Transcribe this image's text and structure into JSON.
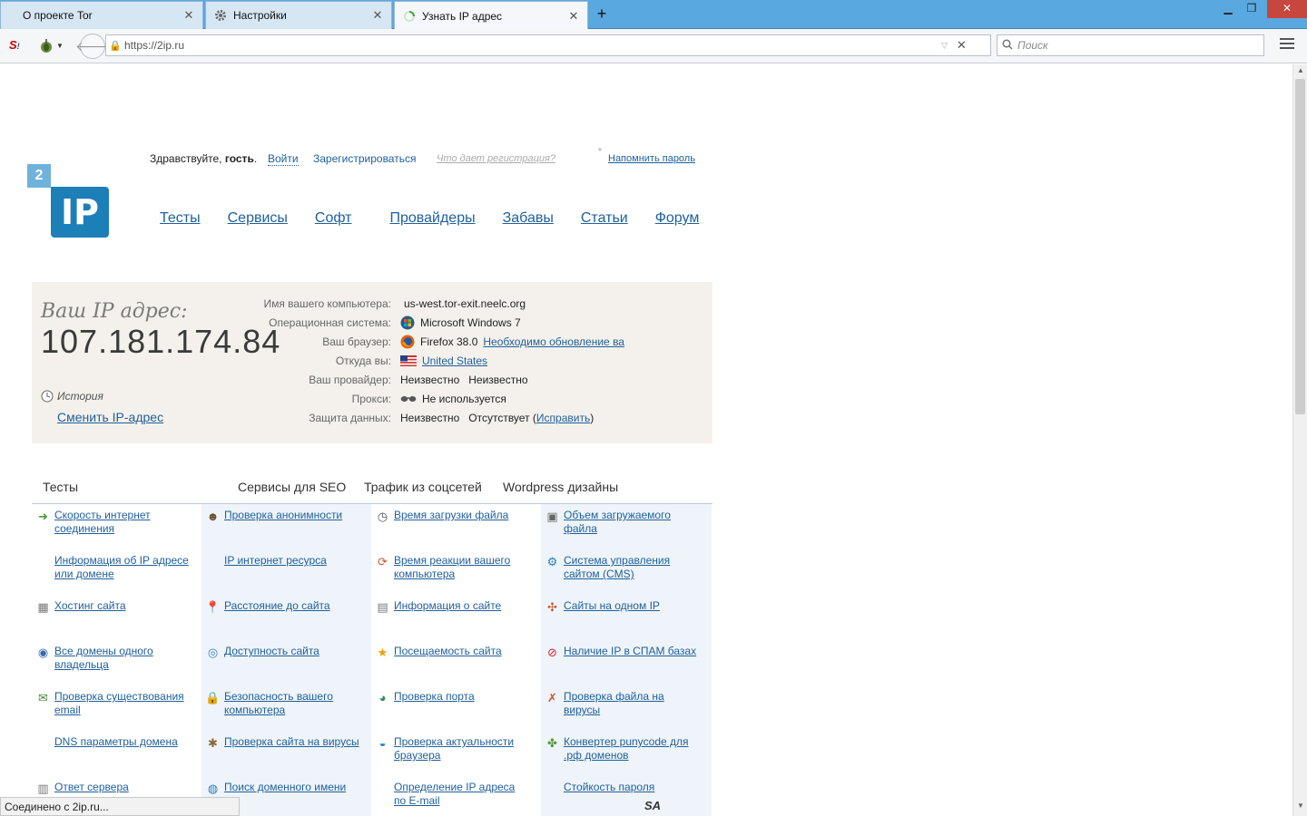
{
  "browser": {
    "tabs": [
      {
        "title": "О проекте Tor",
        "icon": "tor-onion-icon"
      },
      {
        "title": "Настройки",
        "icon": "gear-icon"
      },
      {
        "title": "Узнать IP адрес",
        "icon": "loading-spinner-icon"
      }
    ],
    "url": "https://2ip.ru",
    "search_placeholder": "Поиск"
  },
  "header": {
    "greeting": "Здравствуйте,",
    "guest": "гость",
    "login": "Войти",
    "register": "Зарегистрироваться",
    "why_register": "Что дает регистрация?",
    "remind_password": "Напомнить пароль",
    "logo_number": "2",
    "logo_text": "IP"
  },
  "nav": [
    "Тесты",
    "Сервисы",
    "Софт",
    "Провайдеры",
    "Забавы",
    "Статьи",
    "Форум"
  ],
  "ip_panel": {
    "label": "Ваш IP адрес:",
    "ip": "107.181.174.84",
    "history": "История",
    "change_ip": "Сменить IP-адрес",
    "rows": [
      {
        "label": "Имя вашего компьютера:",
        "value": "us-west.tor-exit.neelc.org"
      },
      {
        "label": "Операционная система:",
        "value": "Microsoft Windows 7"
      },
      {
        "label": "Ваш браузер:",
        "value": "Firefox 38.0",
        "link": "Необходимо обновление ва"
      },
      {
        "label": "Откуда вы:",
        "value": "United States"
      },
      {
        "label": "Ваш провайдер:",
        "value": "Неизвестно",
        "value2": "Неизвестно"
      },
      {
        "label": "Прокси:",
        "value": "Не используется"
      },
      {
        "label": "Защита данных:",
        "value": "Неизвестно",
        "value2": "Отсутствует",
        "link": "Исправить"
      }
    ]
  },
  "sections": [
    "Тесты",
    "Сервисы для SEO",
    "Трафик из соцсетей",
    "Wordpress дизайны"
  ],
  "tests": [
    {
      "line1": "Скорость интернет",
      "line2": "соединения",
      "icon": "speed-arrow-icon"
    },
    {
      "line1": "Проверка анонимности",
      "line2": "",
      "icon": "person-icon"
    },
    {
      "line1": "Время загрузки файла",
      "line2": "",
      "icon": "clock-icon"
    },
    {
      "line1": "Объем загружаемого",
      "line2": "файла",
      "icon": "frame-icon"
    },
    {
      "line1": "Информация об IP адресе",
      "line2": "или домене",
      "icon": ""
    },
    {
      "line1": "IP интернет ресурса",
      "line2": "",
      "icon": ""
    },
    {
      "line1": "Время реакции вашего",
      "line2": "компьютера",
      "icon": "refresh-icon"
    },
    {
      "line1": "Система управления",
      "line2": "сайтом (CMS)",
      "icon": "cms-icon"
    },
    {
      "line1": "Хостинг сайта",
      "line2": "",
      "icon": "table-icon"
    },
    {
      "line1": "Расстояние до сайта",
      "line2": "",
      "icon": "map-pin-icon"
    },
    {
      "line1": "Информация о сайте",
      "line2": "",
      "icon": "document-icon"
    },
    {
      "line1": "Сайты на одном IP",
      "line2": "",
      "icon": "network-icon"
    },
    {
      "line1": "Все домены одного",
      "line2": "владельца",
      "icon": "globe-icon"
    },
    {
      "line1": "Доступность сайта",
      "line2": "",
      "icon": "globe-check-icon"
    },
    {
      "line1": "Посещаемость сайта",
      "line2": "",
      "icon": "star-icon"
    },
    {
      "line1": "Наличие IP в СПАМ базах",
      "line2": "",
      "icon": "no-entry-icon"
    },
    {
      "line1": "Проверка существования",
      "line2": "email",
      "icon": "envelope-icon"
    },
    {
      "line1": "Безопасность вашего",
      "line2": "компьютера",
      "icon": "lock-icon"
    },
    {
      "line1": "Проверка порта",
      "line2": "",
      "icon": "earth-icon"
    },
    {
      "line1": "Проверка файла на",
      "line2": "вирусы",
      "icon": "virus-icon"
    },
    {
      "line1": "DNS параметры домена",
      "line2": "",
      "icon": ""
    },
    {
      "line1": "Проверка сайта на вирусы",
      "line2": "",
      "icon": "bug-icon"
    },
    {
      "line1": "Проверка актуальности",
      "line2": "браузера",
      "icon": "browser-icon"
    },
    {
      "line1": "Конвертер punycode для",
      "line2": ".рф доменов",
      "icon": "puzzle-icon"
    },
    {
      "line1": "Ответ сервера",
      "line2": "",
      "icon": "server-icon"
    },
    {
      "line1": "Поиск доменного имени",
      "line2": "",
      "icon": "globe-search-icon"
    },
    {
      "line1": "Определение IP адреса",
      "line2": "по E-mail",
      "icon": ""
    },
    {
      "line1": "Стойкость пароля",
      "line2": "",
      "icon": ""
    }
  ],
  "status": "Соединено с 2ip.ru...",
  "watermark": "SA"
}
